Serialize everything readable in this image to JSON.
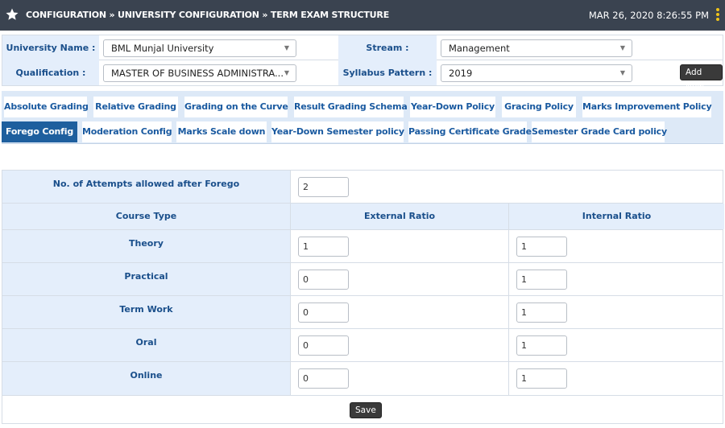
{
  "header": {
    "breadcrumb": "CONFIGURATION » UNIVERSITY CONFIGURATION » TERM EXAM STRUCTURE",
    "datetime": "MAR 26, 2020  8:26:55 PM",
    "icon": "star-icon",
    "menu_icon": "kebab-menu-icon"
  },
  "filters": {
    "university_label": "University Name :",
    "university_value": "BML Munjal University",
    "stream_label": "Stream :",
    "stream_value": "Management",
    "qualification_label": "Qualification :",
    "qualification_value": "MASTER OF BUSINESS ADMINISTRA...",
    "syllabus_label": "Syllabus Pattern :",
    "syllabus_value": "2019",
    "add_new_label": "Add New"
  },
  "tabs_row1": [
    {
      "label": "Absolute Grading"
    },
    {
      "label": "Relative Grading"
    },
    {
      "label": "Grading on the Curve"
    },
    {
      "label": "Result Grading Schema"
    },
    {
      "label": "Year-Down Policy"
    },
    {
      "label": "Gracing Policy"
    },
    {
      "label": "Marks Improvement Policy"
    }
  ],
  "tabs_row2": [
    {
      "label": "Forego Config",
      "active": true
    },
    {
      "label": "Moderation Config"
    },
    {
      "label": "Marks Scale down"
    },
    {
      "label": "Year-Down Semester policy"
    },
    {
      "label": "Passing Certificate Grade"
    },
    {
      "label": "Semester Grade Card policy"
    }
  ],
  "forego": {
    "attempts_label": "No. of Attempts allowed after Forego",
    "attempts_value": "2",
    "col_course_type": "Course Type",
    "col_external": "External Ratio",
    "col_internal": "Internal Ratio",
    "rows": [
      {
        "course_type": "Theory",
        "external": "1",
        "internal": "1"
      },
      {
        "course_type": "Practical",
        "external": "0",
        "internal": "1"
      },
      {
        "course_type": "Term Work",
        "external": "0",
        "internal": "1"
      },
      {
        "course_type": "Oral",
        "external": "0",
        "internal": "1"
      },
      {
        "course_type": "Online",
        "external": "0",
        "internal": "1"
      }
    ],
    "save_label": "Save"
  },
  "colors": {
    "header_bg": "#3a4350",
    "label_bg": "#e4eefb",
    "label_text": "#1a4f8b",
    "active_tab": "#1e5f9e",
    "kebab": "#f0c419"
  }
}
